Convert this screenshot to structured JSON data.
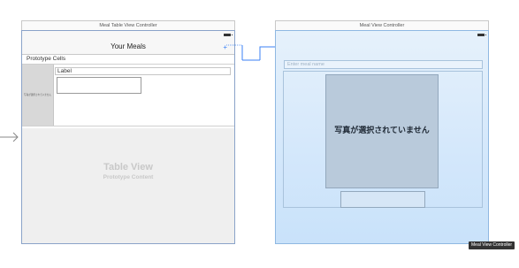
{
  "left_scene": {
    "title": "Meal Table View Controller",
    "nav_title": "Your Meals",
    "add_icon_glyph": "+",
    "section_header": "Prototype Cells",
    "cell": {
      "thumb_text": "写真が選択されていません",
      "label": "Label"
    },
    "table_view_title": "Table View",
    "table_view_subtitle": "Prototype Content"
  },
  "right_scene": {
    "title": "Meal View Controller",
    "text_field_placeholder": "Enter meal name",
    "photo_text": "写真が選択されていません"
  },
  "selection_tag": "Meal View Controller",
  "colors": {
    "scene_border": "#8aa3c9",
    "segue_line": "#3b82f6",
    "right_scene_bg": "#d3e7fb"
  },
  "icons": {
    "entry_arrow": "arrow-right-icon",
    "segue_handle": "segue-dot-icon",
    "battery": "battery-icon"
  }
}
